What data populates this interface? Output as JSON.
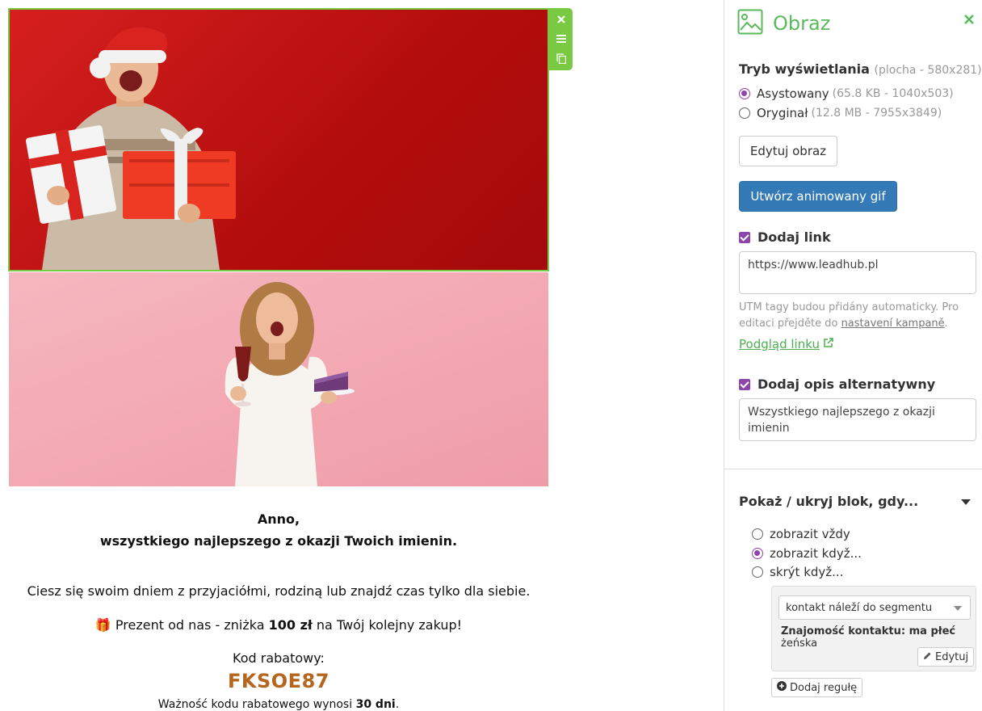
{
  "canvas": {
    "toolbar": {
      "close_icon": "close-icon",
      "menu_icon": "menu-icon",
      "copy_icon": "copy-icon"
    },
    "image1_alt": "Christmas man with gifts",
    "image2_alt": "Woman with cake and wine",
    "greeting_name": "Anno,",
    "greeting_line": "wszystkiego najlepszego z okazji Twoich imienin.",
    "body_line": "Ciesz się swoim dniem z przyjaciółmi, rodziną lub znajdź czas tylko dla siebie.",
    "gift_prefix": "🎁 Prezent od nas - zniżka ",
    "gift_amount": "100 zł",
    "gift_suffix": " na Twój kolejny zakup!",
    "code_label": "Kod rabatowy:",
    "code_value": "FKSOE87",
    "validity_prefix": "Ważność kodu rabatowego wynosi ",
    "validity_days": "30 dni",
    "validity_suffix": "."
  },
  "panel": {
    "title": "Obraz",
    "display_mode": {
      "label": "Tryb wyświetlania",
      "hint": "(plocha - 580x281)"
    },
    "options": [
      {
        "label": "Asystowany",
        "meta": "(65.8 KB - 1040x503)",
        "selected": true
      },
      {
        "label": "Oryginał",
        "meta": "(12.8 MB - 7955x3849)",
        "selected": false
      }
    ],
    "edit_image_button": "Edytuj obraz",
    "create_gif_button": "Utwórz animowany gif",
    "add_link": {
      "label": "Dodaj link",
      "value": "https://www.leadhub.pl"
    },
    "utm_help_1": "UTM tagy budou přidány automaticky. Pro editaci přejděte do ",
    "utm_help_link": "nastavení kampaně",
    "utm_help_2": ".",
    "preview_link": "Podgląd linku",
    "add_alt": {
      "label": "Dodaj opis alternatywny",
      "value": "Wszystkiego najlepszego z okazji imienin"
    },
    "visibility": {
      "title": "Pokaż / ukryj blok, gdy...",
      "options": [
        {
          "label": "zobrazit vždy",
          "selected": false
        },
        {
          "label": "zobrazit když...",
          "selected": true
        },
        {
          "label": "skrýt když...",
          "selected": false
        }
      ],
      "rule_select": "kontakt náleží do segmentu",
      "rule_desc_bold": "Znajomość kontaktu: ma płeć",
      "rule_desc_rest": " żeńska",
      "edit_button": "Edytuj",
      "add_rule_button": "Dodaj regułę"
    },
    "colors": {
      "accent_green": "#5ab95a",
      "accent_purple": "#8e44ad",
      "primary_blue": "#337ab7"
    }
  }
}
